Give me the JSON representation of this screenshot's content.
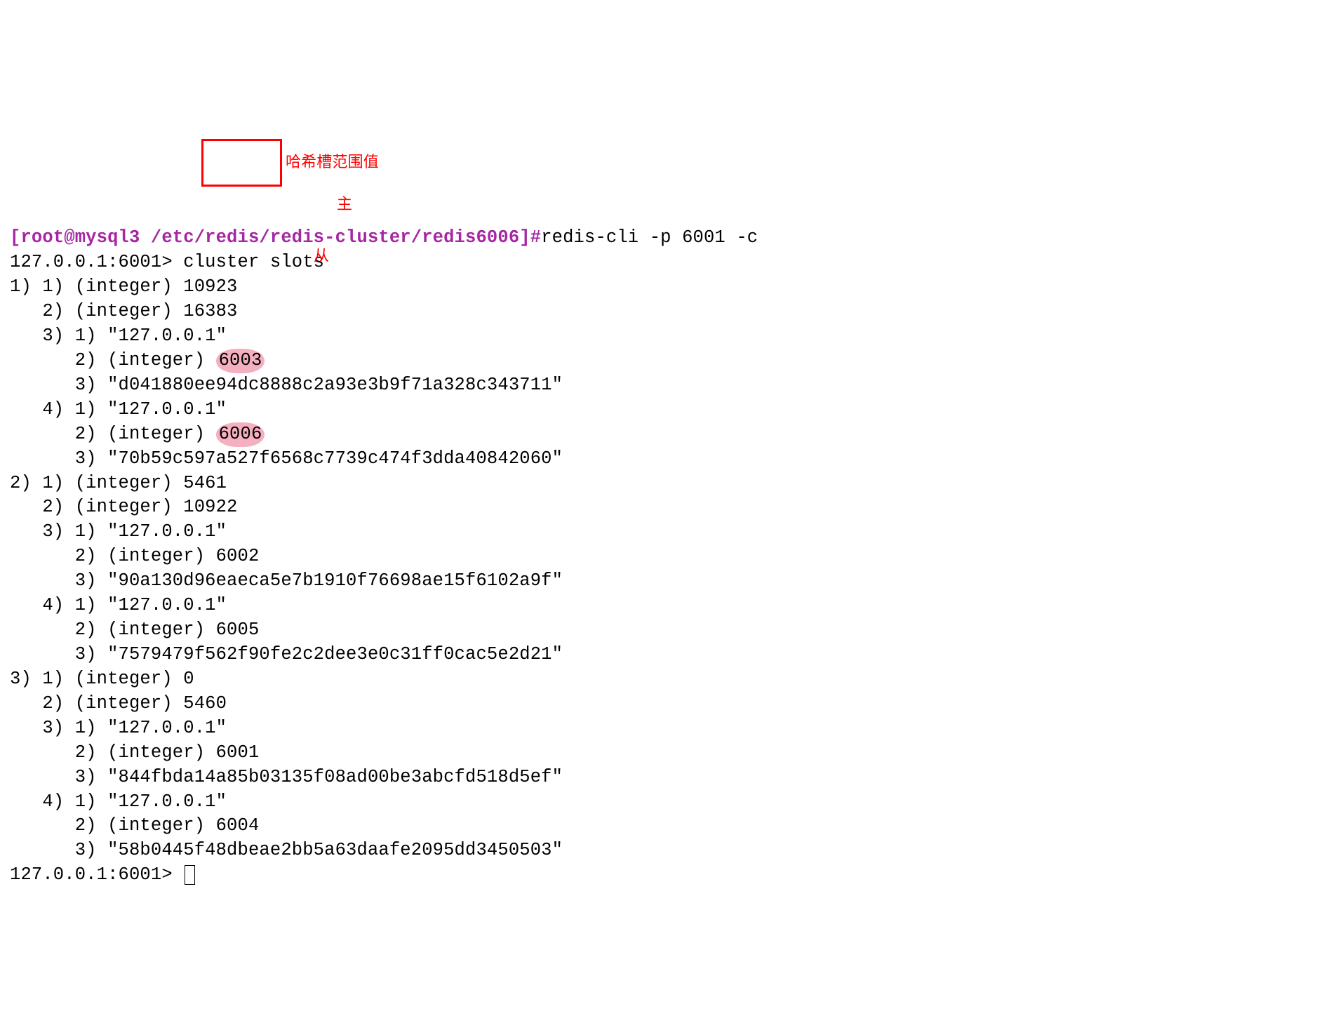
{
  "prompt": {
    "user_host": "[root@mysql3",
    "path": " /etc/redis/redis-cluster/redis6006]",
    "hash": "#",
    "command": "redis-cli -p 6001 -c"
  },
  "cli_prompt": "127.0.0.1:6001> ",
  "cli_command": "cluster slots",
  "slots": [
    {
      "idx": "1)",
      "start": {
        "label": "1) (integer) ",
        "value": "10923"
      },
      "end": {
        "label": "2) (integer) ",
        "value": "16383"
      },
      "master": {
        "label": "3)",
        "ip": {
          "label": "1) ",
          "value": "\"127.0.0.1\""
        },
        "port": {
          "label": "2) (integer) ",
          "value": "6003"
        },
        "id": {
          "label": "3) ",
          "value": "\"d041880ee94dc8888c2a93e3b9f71a328c343711\""
        }
      },
      "replica": {
        "label": "4)",
        "ip": {
          "label": "1) ",
          "value": "\"127.0.0.1\""
        },
        "port": {
          "label": "2) (integer) ",
          "value": "6006"
        },
        "id": {
          "label": "3) ",
          "value": "\"70b59c597a527f6568c7739c474f3dda40842060\""
        }
      }
    },
    {
      "idx": "2)",
      "start": {
        "label": "1) (integer) ",
        "value": "5461"
      },
      "end": {
        "label": "2) (integer) ",
        "value": "10922"
      },
      "master": {
        "label": "3)",
        "ip": {
          "label": "1) ",
          "value": "\"127.0.0.1\""
        },
        "port": {
          "label": "2) (integer) ",
          "value": "6002"
        },
        "id": {
          "label": "3) ",
          "value": "\"90a130d96eaeca5e7b1910f76698ae15f6102a9f\""
        }
      },
      "replica": {
        "label": "4)",
        "ip": {
          "label": "1) ",
          "value": "\"127.0.0.1\""
        },
        "port": {
          "label": "2) (integer) ",
          "value": "6005"
        },
        "id": {
          "label": "3) ",
          "value": "\"7579479f562f90fe2c2dee3e0c31ff0cac5e2d21\""
        }
      }
    },
    {
      "idx": "3)",
      "start": {
        "label": "1) (integer) ",
        "value": "0"
      },
      "end": {
        "label": "2) (integer) ",
        "value": "5460"
      },
      "master": {
        "label": "3)",
        "ip": {
          "label": "1) ",
          "value": "\"127.0.0.1\""
        },
        "port": {
          "label": "2) (integer) ",
          "value": "6001"
        },
        "id": {
          "label": "3) ",
          "value": "\"844fbda14a85b03135f08ad00be3abcfd518d5ef\""
        }
      },
      "replica": {
        "label": "4)",
        "ip": {
          "label": "1) ",
          "value": "\"127.0.0.1\""
        },
        "port": {
          "label": "2) (integer) ",
          "value": "6004"
        },
        "id": {
          "label": "3) ",
          "value": "\"58b0445f48dbeae2bb5a63daafe2095dd3450503\""
        }
      }
    }
  ],
  "annotations": {
    "hash_range": "哈希槽范围值",
    "master": "主",
    "replica": "从"
  },
  "final_prompt": "127.0.0.1:6001> "
}
